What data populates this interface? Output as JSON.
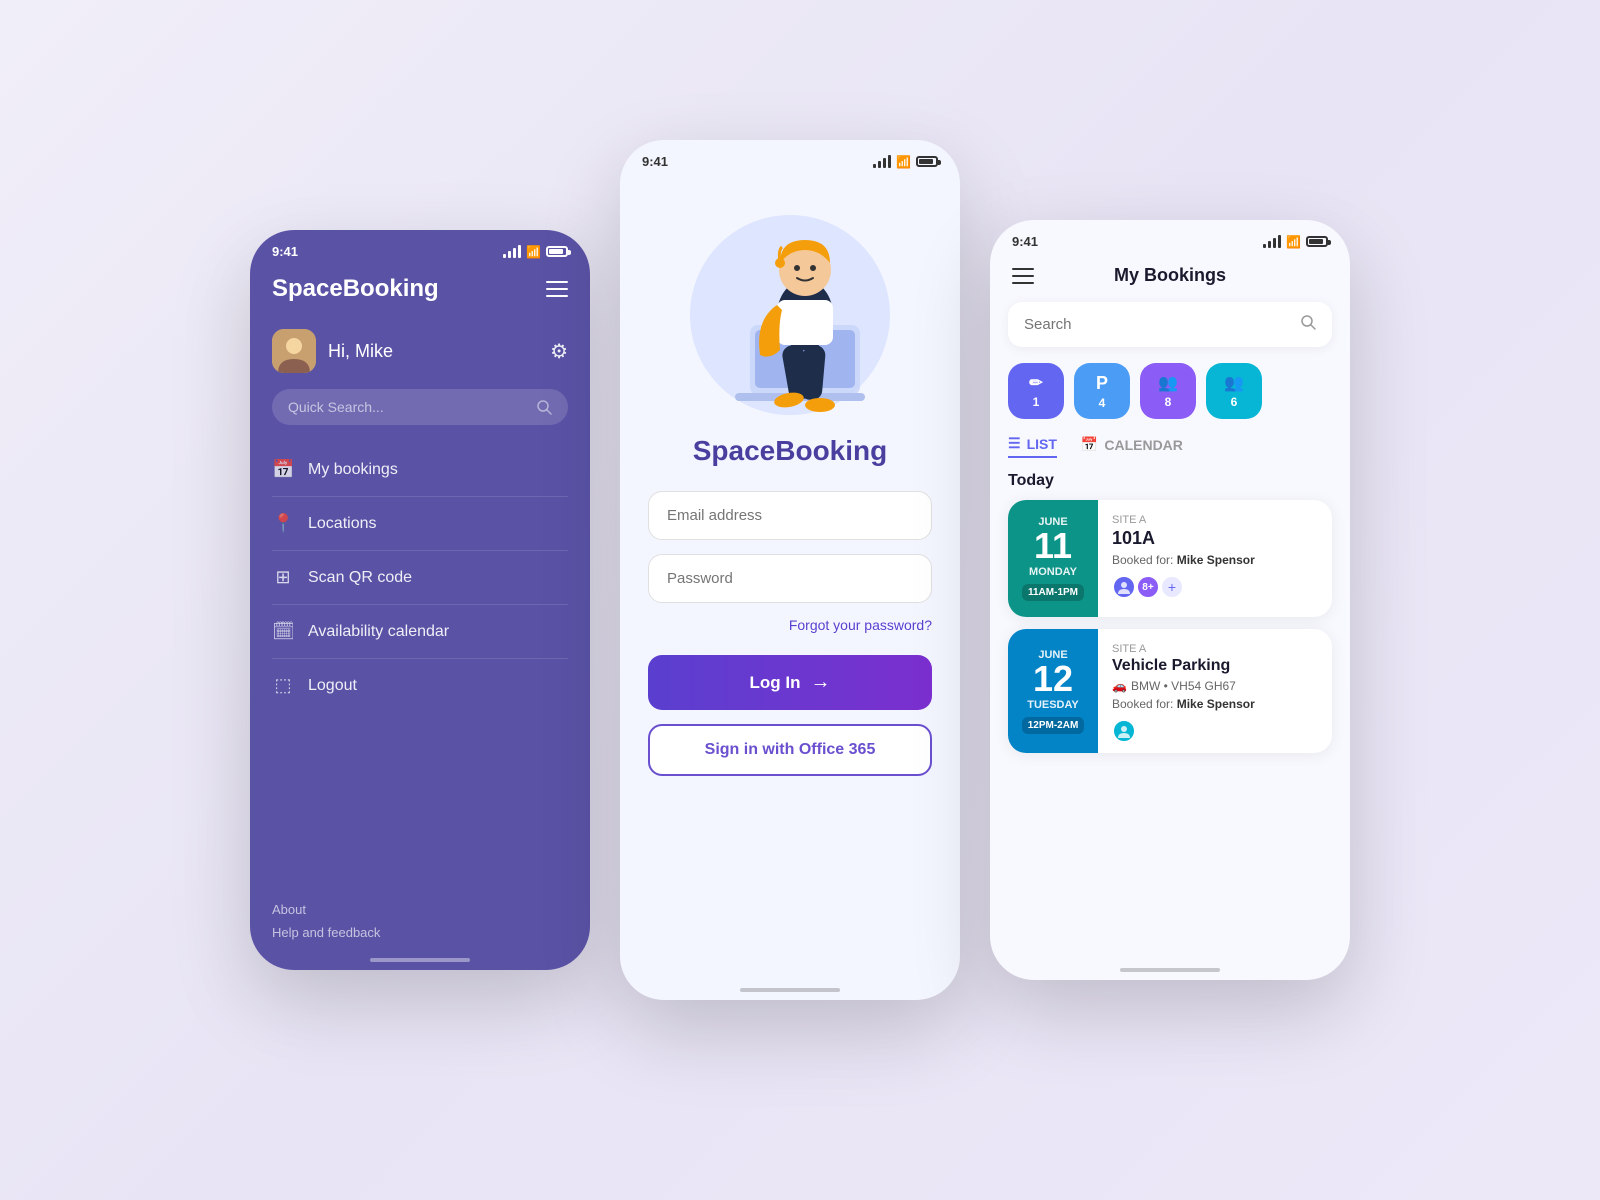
{
  "background": "#ede8f8",
  "phone1": {
    "status_time": "9:41",
    "title": "SpaceBooking",
    "user": "Hi, Mike",
    "search_placeholder": "Quick Search...",
    "menu_items": [
      {
        "label": "My bookings",
        "icon": "📅"
      },
      {
        "label": "Locations",
        "icon": "📍"
      },
      {
        "label": "Scan QR code",
        "icon": "⊞"
      },
      {
        "label": "Availability calendar",
        "icon": "🗓"
      },
      {
        "label": "Logout",
        "icon": "⬚"
      }
    ],
    "footer": [
      "About",
      "Help and feedback"
    ]
  },
  "phone2": {
    "status_time": "9:41",
    "app_name": "SpaceBooking",
    "email_placeholder": "Email address",
    "password_placeholder": "Password",
    "forgot_password": "Forgot your password?",
    "login_button": "Log In",
    "office365_button": "Sign in with Office 365"
  },
  "phone3": {
    "status_time": "9:41",
    "title": "My Bookings",
    "search_placeholder": "Search",
    "chips": [
      {
        "icon": "✏",
        "count": "1",
        "color": "#6366f1"
      },
      {
        "icon": "P",
        "count": "4",
        "color": "#4a9cf5"
      },
      {
        "icon": "👥",
        "count": "8",
        "color": "#8b5cf6"
      },
      {
        "icon": "👥",
        "count": "6",
        "color": "#06b6d4"
      }
    ],
    "tabs": [
      "LIST",
      "CALENDAR"
    ],
    "active_tab": "LIST",
    "today_label": "Today",
    "bookings": [
      {
        "month": "JUNE",
        "day": "11",
        "weekday": "MONDAY",
        "time": "11AM-1PM",
        "site": "SITE A",
        "name": "101A",
        "booked_for": "Mike Spensor",
        "color": "#0d9488"
      },
      {
        "month": "JUNE",
        "day": "12",
        "weekday": "TUESDAY",
        "time": "12PM-2AM",
        "site": "SITE A",
        "name": "Vehicle Parking",
        "vehicle": "BMW • VH54 GH67",
        "booked_for": "Mike Spensor",
        "color": "#0284c7"
      }
    ]
  }
}
